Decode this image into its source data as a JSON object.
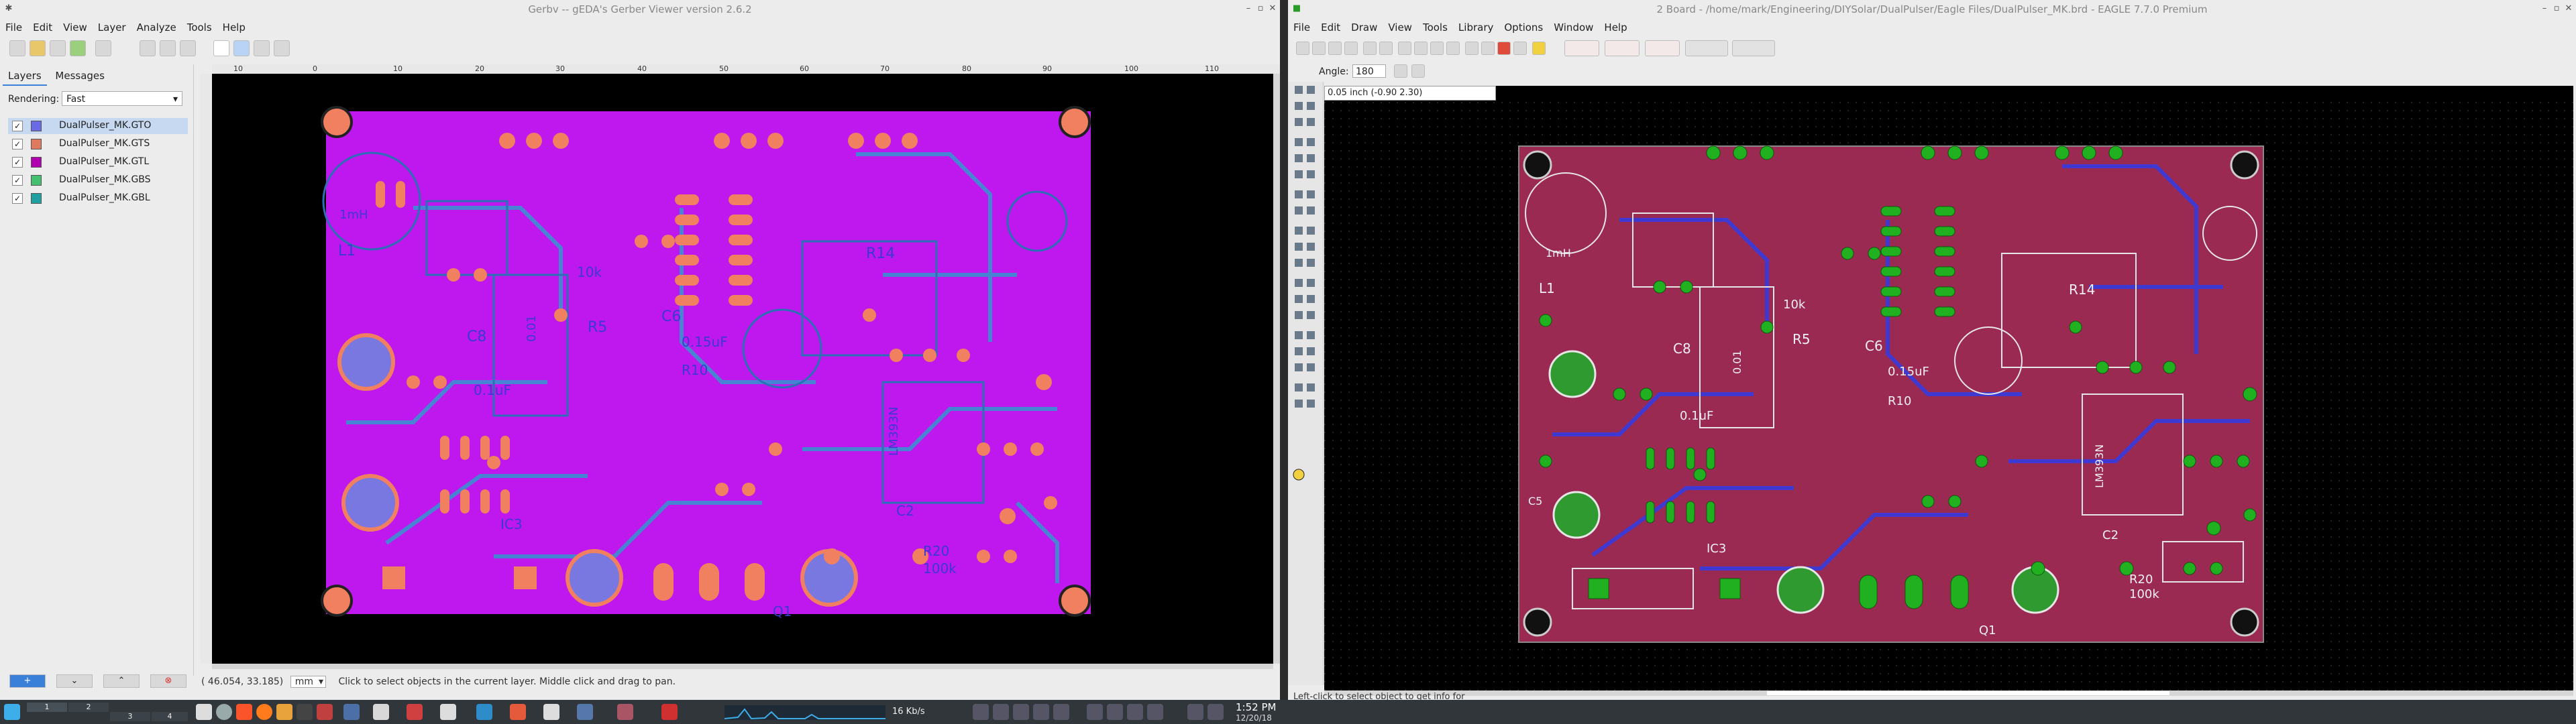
{
  "gerbv": {
    "title": "Gerbv -- gEDA's Gerber Viewer version 2.6.2",
    "menu": [
      "File",
      "Edit",
      "View",
      "Layer",
      "Analyze",
      "Tools",
      "Help"
    ],
    "tabs": [
      "Layers",
      "Messages"
    ],
    "rendering_label": "Rendering:",
    "rendering_value": "Fast",
    "layers": [
      {
        "name": "DualPulser_MK.GTO",
        "color": "#6a6ae6",
        "checked": true
      },
      {
        "name": "DualPulser_MK.GTS",
        "color": "#e07a5f",
        "checked": true
      },
      {
        "name": "DualPulser_MK.GTL",
        "color": "#b000b0",
        "checked": true
      },
      {
        "name": "DualPulser_MK.GBS",
        "color": "#44c070",
        "checked": true
      },
      {
        "name": "DualPulser_MK.GBL",
        "color": "#20a0a0",
        "checked": true
      }
    ],
    "ruler_ticks": [
      "10",
      "0",
      "10",
      "20",
      "30",
      "40",
      "50",
      "60",
      "70",
      "80",
      "90",
      "100",
      "110"
    ],
    "coords": "( 46.054,   33.185)",
    "unit": "mm",
    "status": "Click to select objects in the current layer. Middle click and drag to pan.",
    "board_labels": {
      "L1": "L1",
      "C8": "C8",
      "c6": "C6",
      "r5": "R5",
      "r10": "R10",
      "r14": "R14",
      "ic3": "IC3",
      "ic_lm": "LM393N",
      "r20": "R20",
      "r20v": "100k",
      "c2": "C2",
      "q1": "Q1",
      "v1": "0.15uF",
      "v2": "0.1uF",
      "v3": "0.01",
      "v4": "10k",
      "v5": "1mH"
    }
  },
  "eagle": {
    "title": "2 Board - /home/mark/Engineering/DIYSolar/DualPulser/Eagle Files/DualPulser_MK.brd - EAGLE 7.7.0 Premium",
    "menu": [
      "File",
      "Edit",
      "Draw",
      "View",
      "Tools",
      "Library",
      "Options",
      "Window",
      "Help"
    ],
    "angle_label": "Angle:",
    "angle_value": "180",
    "coord_display": "0.05 inch (-0.90 2.30)",
    "status": "Left-click to select object to get info for",
    "board_labels": {
      "L1": "L1",
      "C8": "C8",
      "c6": "C6",
      "r5": "R5",
      "r10": "R10",
      "r14": "R14",
      "ic3": "IC3",
      "ic_lm": "LM393N",
      "r20": "R20",
      "r20v": "100k",
      "c2": "C2",
      "q1": "Q1",
      "v1": "0.15uF",
      "v2": "0.1uF",
      "v3": "0.01",
      "v4": "10k",
      "v5": "1mH",
      "c5": "C5"
    }
  },
  "taskbar": {
    "time": "1:52 PM",
    "date": "12/20/18",
    "net": "16 Kb/s",
    "desk": [
      "1",
      "2",
      "3",
      "4"
    ]
  }
}
